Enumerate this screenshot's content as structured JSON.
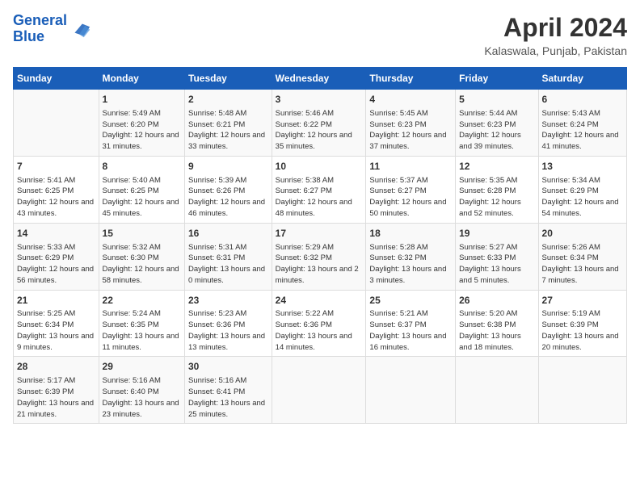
{
  "header": {
    "logo_line1": "General",
    "logo_line2": "Blue",
    "month": "April 2024",
    "location": "Kalaswala, Punjab, Pakistan"
  },
  "weekdays": [
    "Sunday",
    "Monday",
    "Tuesday",
    "Wednesday",
    "Thursday",
    "Friday",
    "Saturday"
  ],
  "weeks": [
    [
      {
        "day": "",
        "sunrise": "",
        "sunset": "",
        "daylight": ""
      },
      {
        "day": "1",
        "sunrise": "Sunrise: 5:49 AM",
        "sunset": "Sunset: 6:20 PM",
        "daylight": "Daylight: 12 hours and 31 minutes."
      },
      {
        "day": "2",
        "sunrise": "Sunrise: 5:48 AM",
        "sunset": "Sunset: 6:21 PM",
        "daylight": "Daylight: 12 hours and 33 minutes."
      },
      {
        "day": "3",
        "sunrise": "Sunrise: 5:46 AM",
        "sunset": "Sunset: 6:22 PM",
        "daylight": "Daylight: 12 hours and 35 minutes."
      },
      {
        "day": "4",
        "sunrise": "Sunrise: 5:45 AM",
        "sunset": "Sunset: 6:23 PM",
        "daylight": "Daylight: 12 hours and 37 minutes."
      },
      {
        "day": "5",
        "sunrise": "Sunrise: 5:44 AM",
        "sunset": "Sunset: 6:23 PM",
        "daylight": "Daylight: 12 hours and 39 minutes."
      },
      {
        "day": "6",
        "sunrise": "Sunrise: 5:43 AM",
        "sunset": "Sunset: 6:24 PM",
        "daylight": "Daylight: 12 hours and 41 minutes."
      }
    ],
    [
      {
        "day": "7",
        "sunrise": "Sunrise: 5:41 AM",
        "sunset": "Sunset: 6:25 PM",
        "daylight": "Daylight: 12 hours and 43 minutes."
      },
      {
        "day": "8",
        "sunrise": "Sunrise: 5:40 AM",
        "sunset": "Sunset: 6:25 PM",
        "daylight": "Daylight: 12 hours and 45 minutes."
      },
      {
        "day": "9",
        "sunrise": "Sunrise: 5:39 AM",
        "sunset": "Sunset: 6:26 PM",
        "daylight": "Daylight: 12 hours and 46 minutes."
      },
      {
        "day": "10",
        "sunrise": "Sunrise: 5:38 AM",
        "sunset": "Sunset: 6:27 PM",
        "daylight": "Daylight: 12 hours and 48 minutes."
      },
      {
        "day": "11",
        "sunrise": "Sunrise: 5:37 AM",
        "sunset": "Sunset: 6:27 PM",
        "daylight": "Daylight: 12 hours and 50 minutes."
      },
      {
        "day": "12",
        "sunrise": "Sunrise: 5:35 AM",
        "sunset": "Sunset: 6:28 PM",
        "daylight": "Daylight: 12 hours and 52 minutes."
      },
      {
        "day": "13",
        "sunrise": "Sunrise: 5:34 AM",
        "sunset": "Sunset: 6:29 PM",
        "daylight": "Daylight: 12 hours and 54 minutes."
      }
    ],
    [
      {
        "day": "14",
        "sunrise": "Sunrise: 5:33 AM",
        "sunset": "Sunset: 6:29 PM",
        "daylight": "Daylight: 12 hours and 56 minutes."
      },
      {
        "day": "15",
        "sunrise": "Sunrise: 5:32 AM",
        "sunset": "Sunset: 6:30 PM",
        "daylight": "Daylight: 12 hours and 58 minutes."
      },
      {
        "day": "16",
        "sunrise": "Sunrise: 5:31 AM",
        "sunset": "Sunset: 6:31 PM",
        "daylight": "Daylight: 13 hours and 0 minutes."
      },
      {
        "day": "17",
        "sunrise": "Sunrise: 5:29 AM",
        "sunset": "Sunset: 6:32 PM",
        "daylight": "Daylight: 13 hours and 2 minutes."
      },
      {
        "day": "18",
        "sunrise": "Sunrise: 5:28 AM",
        "sunset": "Sunset: 6:32 PM",
        "daylight": "Daylight: 13 hours and 3 minutes."
      },
      {
        "day": "19",
        "sunrise": "Sunrise: 5:27 AM",
        "sunset": "Sunset: 6:33 PM",
        "daylight": "Daylight: 13 hours and 5 minutes."
      },
      {
        "day": "20",
        "sunrise": "Sunrise: 5:26 AM",
        "sunset": "Sunset: 6:34 PM",
        "daylight": "Daylight: 13 hours and 7 minutes."
      }
    ],
    [
      {
        "day": "21",
        "sunrise": "Sunrise: 5:25 AM",
        "sunset": "Sunset: 6:34 PM",
        "daylight": "Daylight: 13 hours and 9 minutes."
      },
      {
        "day": "22",
        "sunrise": "Sunrise: 5:24 AM",
        "sunset": "Sunset: 6:35 PM",
        "daylight": "Daylight: 13 hours and 11 minutes."
      },
      {
        "day": "23",
        "sunrise": "Sunrise: 5:23 AM",
        "sunset": "Sunset: 6:36 PM",
        "daylight": "Daylight: 13 hours and 13 minutes."
      },
      {
        "day": "24",
        "sunrise": "Sunrise: 5:22 AM",
        "sunset": "Sunset: 6:36 PM",
        "daylight": "Daylight: 13 hours and 14 minutes."
      },
      {
        "day": "25",
        "sunrise": "Sunrise: 5:21 AM",
        "sunset": "Sunset: 6:37 PM",
        "daylight": "Daylight: 13 hours and 16 minutes."
      },
      {
        "day": "26",
        "sunrise": "Sunrise: 5:20 AM",
        "sunset": "Sunset: 6:38 PM",
        "daylight": "Daylight: 13 hours and 18 minutes."
      },
      {
        "day": "27",
        "sunrise": "Sunrise: 5:19 AM",
        "sunset": "Sunset: 6:39 PM",
        "daylight": "Daylight: 13 hours and 20 minutes."
      }
    ],
    [
      {
        "day": "28",
        "sunrise": "Sunrise: 5:17 AM",
        "sunset": "Sunset: 6:39 PM",
        "daylight": "Daylight: 13 hours and 21 minutes."
      },
      {
        "day": "29",
        "sunrise": "Sunrise: 5:16 AM",
        "sunset": "Sunset: 6:40 PM",
        "daylight": "Daylight: 13 hours and 23 minutes."
      },
      {
        "day": "30",
        "sunrise": "Sunrise: 5:16 AM",
        "sunset": "Sunset: 6:41 PM",
        "daylight": "Daylight: 13 hours and 25 minutes."
      },
      {
        "day": "",
        "sunrise": "",
        "sunset": "",
        "daylight": ""
      },
      {
        "day": "",
        "sunrise": "",
        "sunset": "",
        "daylight": ""
      },
      {
        "day": "",
        "sunrise": "",
        "sunset": "",
        "daylight": ""
      },
      {
        "day": "",
        "sunrise": "",
        "sunset": "",
        "daylight": ""
      }
    ]
  ]
}
